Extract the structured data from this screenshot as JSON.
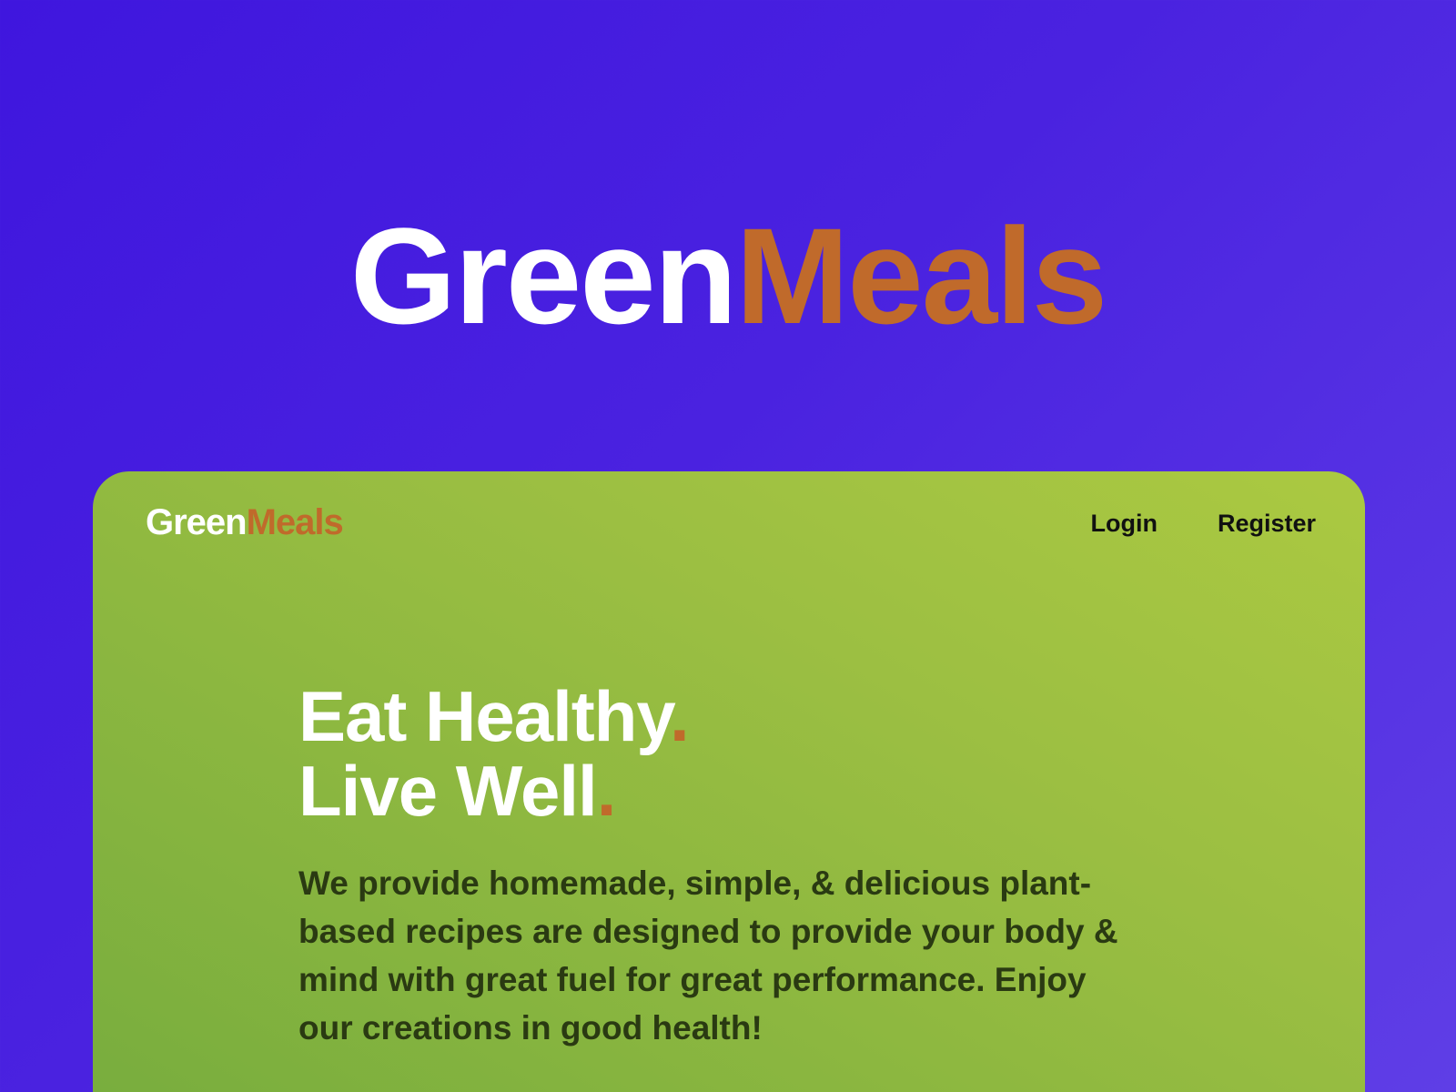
{
  "hero": {
    "brand_part1": "Green",
    "brand_part2": "Meals"
  },
  "nav": {
    "logo_part1": "Green",
    "logo_part2": "Meals",
    "links": [
      {
        "label": "Login"
      },
      {
        "label": "Register"
      }
    ]
  },
  "main": {
    "headline_line1": "Eat Healthy",
    "headline_line2": "Live Well",
    "headline_accent": ".",
    "description": "We provide homemade, simple, & delicious plant-based recipes are designed to provide your body & mind with great fuel for great performance. Enjoy our creations in good health!"
  },
  "colors": {
    "background": "#4a22e0",
    "card_green": "#9cbf42",
    "accent_orange": "#c06a2b",
    "text_white": "#ffffff",
    "body_text": "#2a3a12"
  }
}
